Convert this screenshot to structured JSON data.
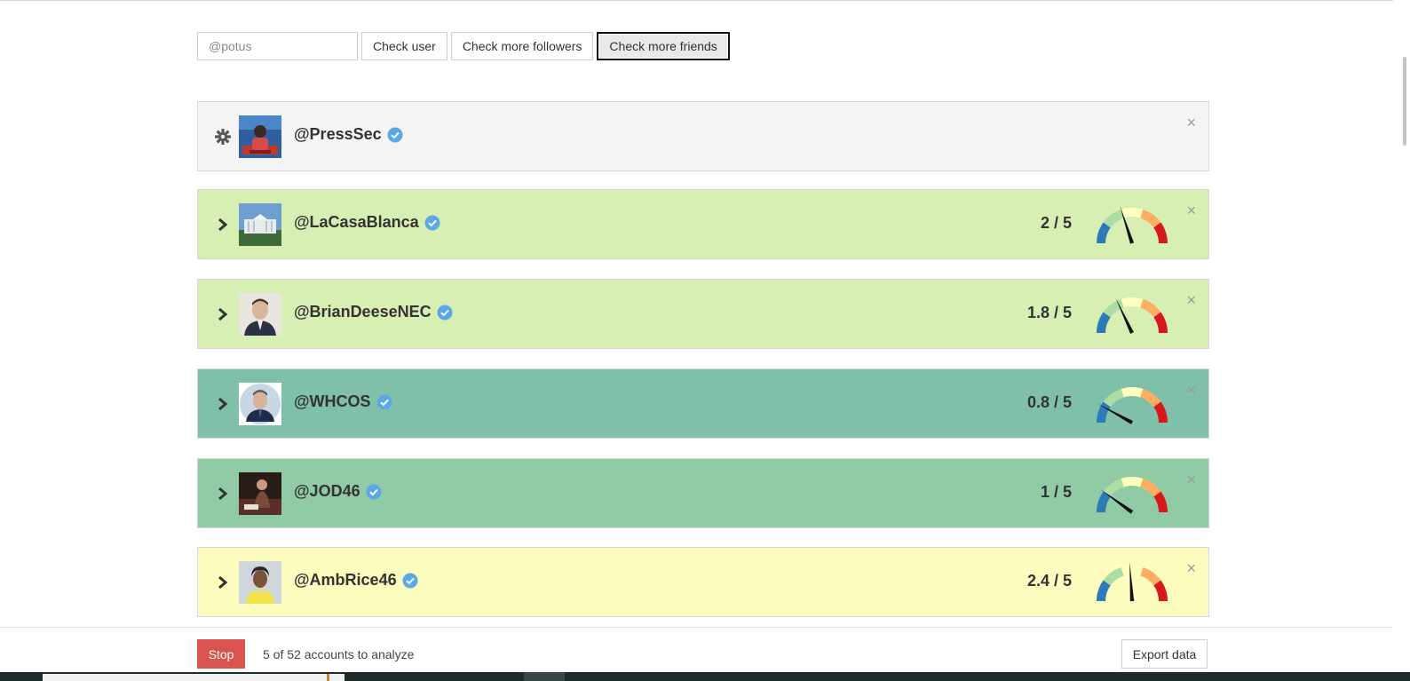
{
  "toolbar": {
    "input_placeholder": "@potus",
    "input_value": "",
    "check_user_label": "Check user",
    "check_followers_label": "Check more followers",
    "check_friends_label": "Check more friends"
  },
  "accounts": [
    {
      "handle": "@PressSec",
      "verified": true,
      "score_text": "",
      "score": null,
      "bg": "#f4f4f4",
      "lead_icon": "gear-icon"
    },
    {
      "handle": "@LaCasaBlanca",
      "verified": true,
      "score_text": "2 / 5",
      "score": 2,
      "bg": "#d8efb4",
      "lead_icon": "chevron-right-icon"
    },
    {
      "handle": "@BrianDeeseNEC",
      "verified": true,
      "score_text": "1.8 / 5",
      "score": 1.8,
      "bg": "#d8efb4",
      "lead_icon": "chevron-right-icon"
    },
    {
      "handle": "@WHCOS",
      "verified": true,
      "score_text": "0.8 / 5",
      "score": 0.8,
      "bg": "#80c0aa",
      "lead_icon": "chevron-right-icon"
    },
    {
      "handle": "@JOD46",
      "verified": true,
      "score_text": "1 / 5",
      "score": 1,
      "bg": "#90cba5",
      "lead_icon": "chevron-right-icon"
    },
    {
      "handle": "@AmbRice46",
      "verified": true,
      "score_text": "2.4 / 5",
      "score": 2.4,
      "bg": "#fcfcbf",
      "lead_icon": "chevron-right-icon"
    }
  ],
  "footer": {
    "stop_label": "Stop",
    "progress_text": "5 of 52 accounts to analyze",
    "export_label": "Export data"
  },
  "colors": {
    "gauge": [
      "#2c7bb6",
      "#abdda4",
      "#ffffbf",
      "#fdae61",
      "#d7191c"
    ],
    "verified": "#5aa9e6",
    "stop": "#d9534f"
  }
}
